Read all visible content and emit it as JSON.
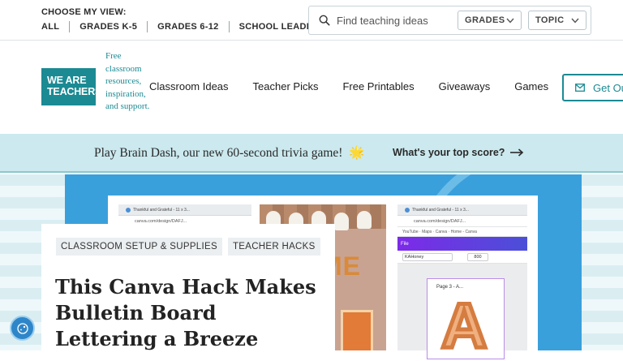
{
  "topbar": {
    "choose_label": "CHOOSE MY VIEW:",
    "views": [
      "ALL",
      "GRADES K-5",
      "GRADES 6-12",
      "SCHOOL LEADERS"
    ],
    "search_placeholder": "Find teaching ideas",
    "grades_label": "GRADES",
    "topic_label": "TOPIC"
  },
  "brand": {
    "logo_line1": "WE ARE",
    "logo_line2": "TEACHERS",
    "tagline": "Free classroom resources, inspiration, and support.",
    "color": "#1b8a93"
  },
  "nav": {
    "items": [
      "Classroom Ideas",
      "Teacher Picks",
      "Free Printables",
      "Giveaways",
      "Games"
    ],
    "cta": "Get Ou"
  },
  "promo": {
    "text": "Play Brain Dash, our new 60-second trivia game!",
    "star": "🌟",
    "link": "What's your top score?"
  },
  "hero": {
    "mock_tab_title": "Thankful and Grateful - 11 x 3...",
    "mock_url": "canva.com/design/DAFJ...",
    "mock2_tab_title": "Thankful and Grateful - 11 x 3...",
    "mock2_url": "canva.com/design/DAFJ...",
    "mock2_links": "YouTube · Maps · Canva · Home - Canva",
    "canva_menu": "File",
    "canva_font": "KAHoney",
    "canva_size": "800",
    "canva_page_label": "Page 3 - A...",
    "canva_letter": "A",
    "photo_letters": "ME"
  },
  "article": {
    "tags": [
      "CLASSROOM SETUP & SUPPLIES",
      "TEACHER HACKS"
    ],
    "headline": "This Canva Hack Makes Bulletin Board Lettering a Breeze"
  },
  "colors": {
    "accent": "#1b8a93",
    "promo_bg": "#cbe9ee",
    "hero_blue": "#3aa0dc"
  }
}
